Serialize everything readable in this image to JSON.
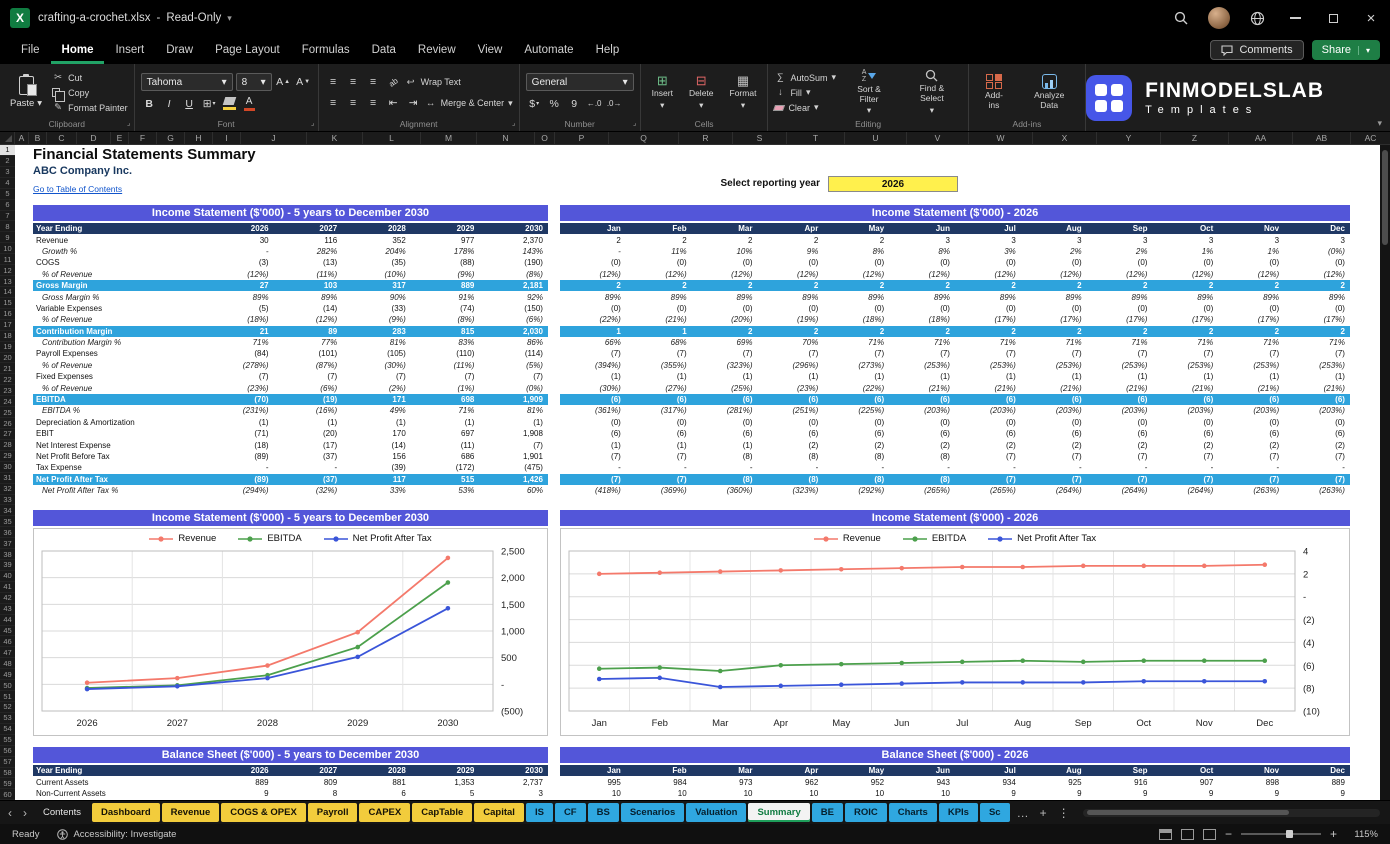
{
  "title_bar": {
    "document_title": "crafting-a-crochet.xlsx",
    "read_only_label": "Read-Only"
  },
  "menu_bar": {
    "items": [
      "File",
      "Home",
      "Insert",
      "Draw",
      "Page Layout",
      "Formulas",
      "Data",
      "Review",
      "View",
      "Automate",
      "Help"
    ],
    "active_item": "Home",
    "comments_label": "Comments",
    "share_label": "Share"
  },
  "ribbon": {
    "clipboard": {
      "group_label": "Clipboard",
      "paste": "Paste",
      "cut": "Cut",
      "copy": "Copy",
      "format_painter": "Format Painter"
    },
    "font": {
      "group_label": "Font",
      "font_name": "Tahoma",
      "font_size": "8"
    },
    "alignment": {
      "group_label": "Alignment",
      "wrap_text": "Wrap Text",
      "merge_center": "Merge & Center"
    },
    "number": {
      "group_label": "Number",
      "format": "General"
    },
    "cells": {
      "group_label": "Cells",
      "insert": "Insert",
      "delete": "Delete",
      "format": "Format"
    },
    "editing": {
      "group_label": "Editing",
      "autosum": "AutoSum",
      "fill": "Fill",
      "clear": "Clear",
      "sort_filter": "Sort & Filter",
      "find_select": "Find & Select"
    },
    "addins": {
      "group_label": "Add-ins",
      "addins": "Add-ins",
      "analyze_data": "Analyze Data"
    },
    "brand": {
      "name": "FINMODELSLAB",
      "subtitle": "Templates"
    }
  },
  "grid": {
    "column_headers": [
      "A",
      "B",
      "C",
      "D",
      "E",
      "F",
      "G",
      "H",
      "I",
      "J",
      "K",
      "L",
      "M",
      "N",
      "O",
      "P",
      "Q",
      "R",
      "S",
      "T",
      "U",
      "V",
      "W",
      "X",
      "Y",
      "Z",
      "AA",
      "AB",
      "AC"
    ],
    "row_count": 60
  },
  "sheet": {
    "title": "Financial Statements Summary",
    "company": "ABC Company Inc.",
    "toc_link": "Go to Table of Contents",
    "select_year_label": "Select reporting year",
    "selected_year": "2026"
  },
  "income_statement_5yr": {
    "header": "Income Statement ($'000) - 5 years to December 2030",
    "col_header_label": "Year Ending",
    "columns": [
      "2026",
      "2027",
      "2028",
      "2029",
      "2030"
    ],
    "rows": [
      {
        "label": "Revenue",
        "style": "normal",
        "values": [
          "30",
          "116",
          "352",
          "977",
          "2,370"
        ]
      },
      {
        "label": "Growth %",
        "style": "pct",
        "values": [
          "-",
          "282%",
          "204%",
          "178%",
          "143%"
        ]
      },
      {
        "label": "COGS",
        "style": "normal",
        "values": [
          "(3)",
          "(13)",
          "(35)",
          "(88)",
          "(190)"
        ]
      },
      {
        "label": "% of Revenue",
        "style": "pct",
        "values": [
          "(12%)",
          "(11%)",
          "(10%)",
          "(9%)",
          "(8%)"
        ]
      },
      {
        "label": "Gross Margin",
        "style": "hi",
        "values": [
          "27",
          "103",
          "317",
          "889",
          "2,181"
        ]
      },
      {
        "label": "Gross Margin %",
        "style": "pct",
        "values": [
          "89%",
          "89%",
          "90%",
          "91%",
          "92%"
        ]
      },
      {
        "label": "Variable Expenses",
        "style": "normal",
        "values": [
          "(5)",
          "(14)",
          "(33)",
          "(74)",
          "(150)"
        ]
      },
      {
        "label": "% of Revenue",
        "style": "pct",
        "values": [
          "(18%)",
          "(12%)",
          "(9%)",
          "(8%)",
          "(6%)"
        ]
      },
      {
        "label": "Contribution Margin",
        "style": "hi",
        "values": [
          "21",
          "89",
          "283",
          "815",
          "2,030"
        ]
      },
      {
        "label": "Contribution Margin %",
        "style": "pct",
        "values": [
          "71%",
          "77%",
          "81%",
          "83%",
          "86%"
        ]
      },
      {
        "label": "Payroll Expenses",
        "style": "normal",
        "values": [
          "(84)",
          "(101)",
          "(105)",
          "(110)",
          "(114)"
        ]
      },
      {
        "label": "% of Revenue",
        "style": "pct",
        "values": [
          "(278%)",
          "(87%)",
          "(30%)",
          "(11%)",
          "(5%)"
        ]
      },
      {
        "label": "Fixed Expenses",
        "style": "normal",
        "values": [
          "(7)",
          "(7)",
          "(7)",
          "(7)",
          "(7)"
        ]
      },
      {
        "label": "% of Revenue",
        "style": "pct",
        "values": [
          "(23%)",
          "(6%)",
          "(2%)",
          "(1%)",
          "(0%)"
        ]
      },
      {
        "label": "EBITDA",
        "style": "hi",
        "values": [
          "(70)",
          "(19)",
          "171",
          "698",
          "1,909"
        ]
      },
      {
        "label": "EBITDA %",
        "style": "pct",
        "values": [
          "(231%)",
          "(16%)",
          "49%",
          "71%",
          "81%"
        ]
      },
      {
        "label": "Depreciation & Amortization",
        "style": "normal",
        "values": [
          "(1)",
          "(1)",
          "(1)",
          "(1)",
          "(1)"
        ]
      },
      {
        "label": "EBIT",
        "style": "normal",
        "values": [
          "(71)",
          "(20)",
          "170",
          "697",
          "1,908"
        ]
      },
      {
        "label": "Net Interest Expense",
        "style": "normal",
        "values": [
          "(18)",
          "(17)",
          "(14)",
          "(11)",
          "(7)"
        ]
      },
      {
        "label": "Net Profit Before Tax",
        "style": "normal",
        "values": [
          "(89)",
          "(37)",
          "156",
          "686",
          "1,901"
        ]
      },
      {
        "label": "Tax Expense",
        "style": "normal",
        "values": [
          "-",
          "-",
          "(39)",
          "(172)",
          "(475)"
        ]
      },
      {
        "label": "Net Profit After Tax",
        "style": "hi",
        "values": [
          "(89)",
          "(37)",
          "117",
          "515",
          "1,426"
        ]
      },
      {
        "label": "Net Profit After Tax %",
        "style": "pct",
        "values": [
          "(294%)",
          "(32%)",
          "33%",
          "53%",
          "60%"
        ]
      }
    ]
  },
  "income_statement_2026": {
    "header": "Income Statement ($'000) - 2026",
    "columns": [
      "Jan",
      "Feb",
      "Mar",
      "Apr",
      "May",
      "Jun",
      "Jul",
      "Aug",
      "Sep",
      "Oct",
      "Nov",
      "Dec"
    ],
    "rows": [
      {
        "style": "normal",
        "values": [
          "2",
          "2",
          "2",
          "2",
          "2",
          "3",
          "3",
          "3",
          "3",
          "3",
          "3",
          "3"
        ]
      },
      {
        "style": "pct",
        "values": [
          "-",
          "11%",
          "10%",
          "9%",
          "8%",
          "8%",
          "3%",
          "2%",
          "2%",
          "1%",
          "1%",
          "(0%)"
        ]
      },
      {
        "style": "normal",
        "values": [
          "(0)",
          "(0)",
          "(0)",
          "(0)",
          "(0)",
          "(0)",
          "(0)",
          "(0)",
          "(0)",
          "(0)",
          "(0)",
          "(0)"
        ]
      },
      {
        "style": "pct",
        "values": [
          "(12%)",
          "(12%)",
          "(12%)",
          "(12%)",
          "(12%)",
          "(12%)",
          "(12%)",
          "(12%)",
          "(12%)",
          "(12%)",
          "(12%)",
          "(12%)"
        ]
      },
      {
        "style": "hi",
        "values": [
          "2",
          "2",
          "2",
          "2",
          "2",
          "2",
          "2",
          "2",
          "2",
          "2",
          "2",
          "2"
        ]
      },
      {
        "style": "pct",
        "values": [
          "89%",
          "89%",
          "89%",
          "89%",
          "89%",
          "89%",
          "89%",
          "89%",
          "89%",
          "89%",
          "89%",
          "89%"
        ]
      },
      {
        "style": "normal",
        "values": [
          "(0)",
          "(0)",
          "(0)",
          "(0)",
          "(0)",
          "(0)",
          "(0)",
          "(0)",
          "(0)",
          "(0)",
          "(0)",
          "(0)"
        ]
      },
      {
        "style": "pct",
        "values": [
          "(22%)",
          "(21%)",
          "(20%)",
          "(19%)",
          "(18%)",
          "(18%)",
          "(17%)",
          "(17%)",
          "(17%)",
          "(17%)",
          "(17%)",
          "(17%)"
        ]
      },
      {
        "style": "hi",
        "values": [
          "1",
          "1",
          "2",
          "2",
          "2",
          "2",
          "2",
          "2",
          "2",
          "2",
          "2",
          "2"
        ]
      },
      {
        "style": "pct",
        "values": [
          "66%",
          "68%",
          "69%",
          "70%",
          "71%",
          "71%",
          "71%",
          "71%",
          "71%",
          "71%",
          "71%",
          "71%"
        ]
      },
      {
        "style": "normal",
        "values": [
          "(7)",
          "(7)",
          "(7)",
          "(7)",
          "(7)",
          "(7)",
          "(7)",
          "(7)",
          "(7)",
          "(7)",
          "(7)",
          "(7)"
        ]
      },
      {
        "style": "pct",
        "values": [
          "(394%)",
          "(355%)",
          "(323%)",
          "(296%)",
          "(273%)",
          "(253%)",
          "(253%)",
          "(253%)",
          "(253%)",
          "(253%)",
          "(253%)",
          "(253%)"
        ]
      },
      {
        "style": "normal",
        "values": [
          "(1)",
          "(1)",
          "(1)",
          "(1)",
          "(1)",
          "(1)",
          "(1)",
          "(1)",
          "(1)",
          "(1)",
          "(1)",
          "(1)"
        ]
      },
      {
        "style": "pct",
        "values": [
          "(30%)",
          "(27%)",
          "(25%)",
          "(23%)",
          "(22%)",
          "(21%)",
          "(21%)",
          "(21%)",
          "(21%)",
          "(21%)",
          "(21%)",
          "(21%)"
        ]
      },
      {
        "style": "hi",
        "values": [
          "(6)",
          "(6)",
          "(6)",
          "(6)",
          "(6)",
          "(6)",
          "(6)",
          "(6)",
          "(6)",
          "(6)",
          "(6)",
          "(6)"
        ]
      },
      {
        "style": "pct",
        "values": [
          "(361%)",
          "(317%)",
          "(281%)",
          "(251%)",
          "(225%)",
          "(203%)",
          "(203%)",
          "(203%)",
          "(203%)",
          "(203%)",
          "(203%)",
          "(203%)"
        ]
      },
      {
        "style": "normal",
        "values": [
          "(0)",
          "(0)",
          "(0)",
          "(0)",
          "(0)",
          "(0)",
          "(0)",
          "(0)",
          "(0)",
          "(0)",
          "(0)",
          "(0)"
        ]
      },
      {
        "style": "normal",
        "values": [
          "(6)",
          "(6)",
          "(6)",
          "(6)",
          "(6)",
          "(6)",
          "(6)",
          "(6)",
          "(6)",
          "(6)",
          "(6)",
          "(6)"
        ]
      },
      {
        "style": "normal",
        "values": [
          "(1)",
          "(1)",
          "(1)",
          "(2)",
          "(2)",
          "(2)",
          "(2)",
          "(2)",
          "(2)",
          "(2)",
          "(2)",
          "(2)"
        ]
      },
      {
        "style": "normal",
        "values": [
          "(7)",
          "(7)",
          "(8)",
          "(8)",
          "(8)",
          "(8)",
          "(7)",
          "(7)",
          "(7)",
          "(7)",
          "(7)",
          "(7)"
        ]
      },
      {
        "style": "normal",
        "values": [
          "-",
          "-",
          "-",
          "-",
          "-",
          "-",
          "-",
          "-",
          "-",
          "-",
          "-",
          "-"
        ]
      },
      {
        "style": "hi",
        "values": [
          "(7)",
          "(7)",
          "(8)",
          "(8)",
          "(8)",
          "(8)",
          "(7)",
          "(7)",
          "(7)",
          "(7)",
          "(7)",
          "(7)"
        ]
      },
      {
        "style": "pct",
        "values": [
          "(418%)",
          "(369%)",
          "(360%)",
          "(323%)",
          "(292%)",
          "(265%)",
          "(265%)",
          "(264%)",
          "(264%)",
          "(264%)",
          "(263%)",
          "(263%)"
        ]
      }
    ]
  },
  "chart_data": [
    {
      "type": "line",
      "header": "Income Statement ($'000) - 5 years to December 2030",
      "categories": [
        "2026",
        "2027",
        "2028",
        "2029",
        "2030"
      ],
      "series": [
        {
          "name": "Revenue",
          "color": "#F4796B",
          "values": [
            30,
            116,
            352,
            977,
            2370
          ]
        },
        {
          "name": "EBITDA",
          "color": "#4CA04C",
          "values": [
            -70,
            -19,
            171,
            698,
            1909
          ]
        },
        {
          "name": "Net Profit After Tax",
          "color": "#3A55D9",
          "values": [
            -89,
            -37,
            117,
            515,
            1426
          ]
        }
      ],
      "ylim": [
        -500,
        2500
      ],
      "yticks": [
        "2,500",
        "2,000",
        "1,500",
        "1,000",
        "500",
        "-",
        "(500)"
      ],
      "legend_position": "top",
      "grid": true
    },
    {
      "type": "line",
      "header": "Income Statement ($'000) - 2026",
      "categories": [
        "Jan",
        "Feb",
        "Mar",
        "Apr",
        "May",
        "Jun",
        "Jul",
        "Aug",
        "Sep",
        "Oct",
        "Nov",
        "Dec"
      ],
      "series": [
        {
          "name": "Revenue",
          "color": "#F4796B",
          "values": [
            2.0,
            2.1,
            2.2,
            2.3,
            2.4,
            2.5,
            2.6,
            2.6,
            2.7,
            2.7,
            2.7,
            2.8
          ]
        },
        {
          "name": "EBITDA",
          "color": "#4CA04C",
          "values": [
            -6.3,
            -6.2,
            -6.5,
            -6.0,
            -5.9,
            -5.8,
            -5.7,
            -5.6,
            -5.7,
            -5.6,
            -5.6,
            -5.6
          ]
        },
        {
          "name": "Net Profit After Tax",
          "color": "#3A55D9",
          "values": [
            -7.2,
            -7.1,
            -7.9,
            -7.8,
            -7.7,
            -7.6,
            -7.5,
            -7.5,
            -7.5,
            -7.4,
            -7.4,
            -7.4
          ]
        }
      ],
      "ylim": [
        -10,
        4
      ],
      "yticks": [
        "4",
        "2",
        "-",
        "(2)",
        "(4)",
        "(6)",
        "(8)",
        "(10)"
      ],
      "legend_position": "top",
      "grid": true
    }
  ],
  "balance_sheet_5yr": {
    "header": "Balance Sheet ($'000) - 5 years to December 2030",
    "col_header_label": "Year Ending",
    "columns": [
      "2026",
      "2027",
      "2028",
      "2029",
      "2030"
    ],
    "rows": [
      {
        "label": "Current Assets",
        "style": "normal",
        "values": [
          "889",
          "809",
          "881",
          "1,353",
          "2,737"
        ]
      },
      {
        "label": "Non-Current Assets",
        "style": "normal",
        "values": [
          "9",
          "8",
          "6",
          "5",
          "3"
        ]
      }
    ]
  },
  "balance_sheet_2026": {
    "header": "Balance Sheet ($'000) - 2026",
    "columns": [
      "Jan",
      "Feb",
      "Mar",
      "Apr",
      "May",
      "Jun",
      "Jul",
      "Aug",
      "Sep",
      "Oct",
      "Nov",
      "Dec"
    ],
    "rows": [
      {
        "style": "normal",
        "values": [
          "995",
          "984",
          "973",
          "962",
          "952",
          "943",
          "934",
          "925",
          "916",
          "907",
          "898",
          "889"
        ]
      },
      {
        "style": "normal",
        "values": [
          "10",
          "10",
          "10",
          "10",
          "10",
          "10",
          "9",
          "9",
          "9",
          "9",
          "9",
          "9"
        ]
      }
    ]
  },
  "sheet_tabs": {
    "tabs": [
      {
        "label": "Contents",
        "type": "plain"
      },
      {
        "label": "Dashboard",
        "type": "yellow"
      },
      {
        "label": "Revenue",
        "type": "yellow"
      },
      {
        "label": "COGS & OPEX",
        "type": "yellow"
      },
      {
        "label": "Payroll",
        "type": "yellow"
      },
      {
        "label": "CAPEX",
        "type": "yellow"
      },
      {
        "label": "CapTable",
        "type": "yellow"
      },
      {
        "label": "Capital",
        "type": "yellow"
      },
      {
        "label": "IS",
        "type": "blue"
      },
      {
        "label": "CF",
        "type": "blue"
      },
      {
        "label": "BS",
        "type": "blue"
      },
      {
        "label": "Scenarios",
        "type": "blue"
      },
      {
        "label": "Valuation",
        "type": "blue"
      },
      {
        "label": "Summary",
        "type": "active"
      },
      {
        "label": "BE",
        "type": "blue"
      },
      {
        "label": "ROIC",
        "type": "blue"
      },
      {
        "label": "Charts",
        "type": "blue"
      },
      {
        "label": "KPIs",
        "type": "blue"
      },
      {
        "label": "Sc",
        "type": "blue"
      }
    ]
  },
  "status_bar": {
    "ready": "Ready",
    "accessibility": "Accessibility: Investigate",
    "zoom": "115%"
  },
  "icon_glyphs": {
    "dropdown-chevron": "▾",
    "scissors": "✂",
    "brush": "✎",
    "sum": "∑",
    "grid-plus": "⊞",
    "grid-minus": "⊟",
    "grid": "▦",
    "down-arrow": "↓",
    "wrap-return": "↩",
    "merge-arrows": "↔",
    "ellipsis": "…",
    "vertical-dots": "⋮",
    "nav-left": "‹",
    "nav-right": "›",
    "close": "×"
  }
}
